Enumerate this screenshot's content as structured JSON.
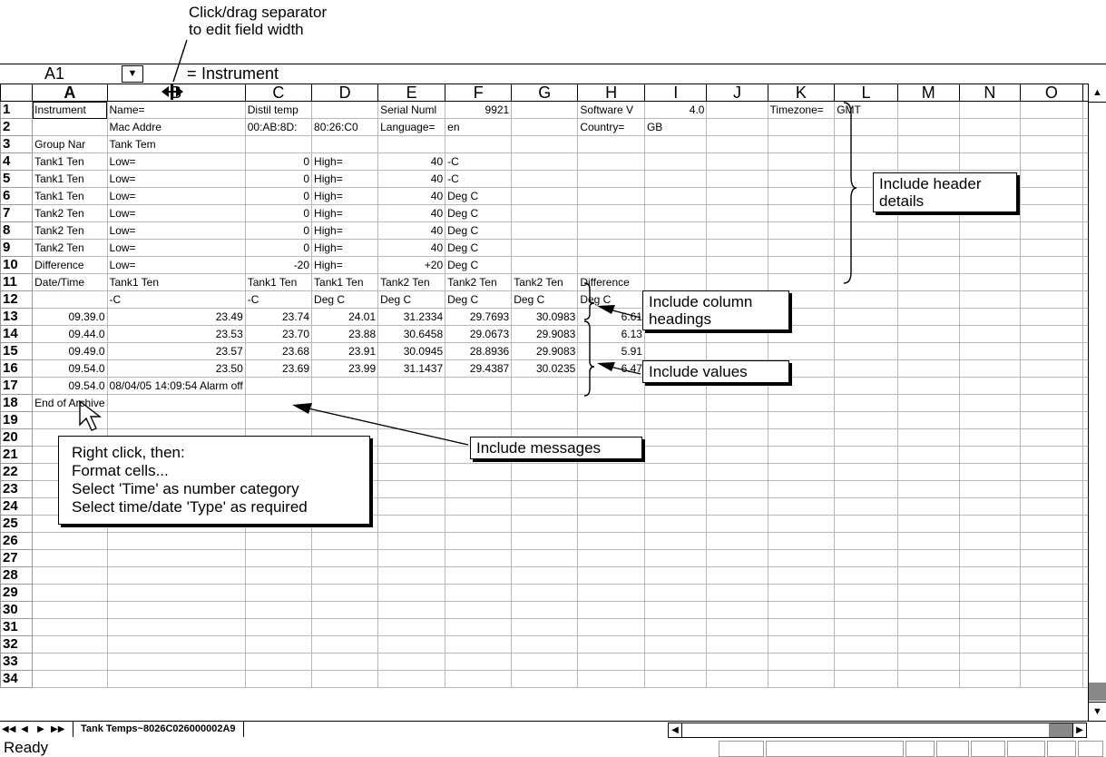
{
  "annotations": {
    "top_line1": "Click/drag separator",
    "top_line2": "to edit field width",
    "header": "Include header details",
    "column_headings": "Include column headings",
    "values": "Include values",
    "messages": "Include messages",
    "format_lines": [
      "Right click, then:",
      "Format cells...",
      "Select 'Time' as number category",
      "Select time/date 'Type' as required"
    ]
  },
  "formula_bar": {
    "cell_ref": "A1",
    "equals": "=",
    "value": "Instrument"
  },
  "columns": [
    "A",
    "B",
    "C",
    "D",
    "E",
    "F",
    "G",
    "H",
    "I",
    "J",
    "K",
    "L",
    "M",
    "N",
    "O"
  ],
  "rows": [
    [
      "Instrument",
      "Name=",
      "Distil temp",
      "",
      "Serial Numl",
      "9921",
      "",
      "Software V",
      "4.0",
      "",
      "Timezone=",
      "GMT",
      "",
      "",
      ""
    ],
    [
      "",
      "Mac Addre",
      "00:AB:8D:",
      "80:26:C0",
      "Language=",
      "en",
      "",
      "Country=",
      "GB",
      "",
      "",
      "",
      "",
      "",
      ""
    ],
    [
      "Group Nar",
      "Tank Tem",
      "",
      "",
      "",
      "",
      "",
      "",
      "",
      "",
      "",
      "",
      "",
      "",
      ""
    ],
    [
      "Tank1 Ten",
      "Low=",
      "0",
      "High=",
      "40",
      "-C",
      "",
      "",
      "",
      "",
      "",
      "",
      "",
      "",
      ""
    ],
    [
      "Tank1 Ten",
      "Low=",
      "0",
      "High=",
      "40",
      "-C",
      "",
      "",
      "",
      "",
      "",
      "",
      "",
      "",
      ""
    ],
    [
      "Tank1 Ten",
      "Low=",
      "0",
      "High=",
      "40",
      "Deg C",
      "",
      "",
      "",
      "",
      "",
      "",
      "",
      "",
      ""
    ],
    [
      "Tank2 Ten",
      "Low=",
      "0",
      "High=",
      "40",
      "Deg C",
      "",
      "",
      "",
      "",
      "",
      "",
      "",
      "",
      ""
    ],
    [
      "Tank2 Ten",
      "Low=",
      "0",
      "High=",
      "40",
      "Deg C",
      "",
      "",
      "",
      "",
      "",
      "",
      "",
      "",
      ""
    ],
    [
      "Tank2 Ten",
      "Low=",
      "0",
      "High=",
      "40",
      "Deg C",
      "",
      "",
      "",
      "",
      "",
      "",
      "",
      "",
      ""
    ],
    [
      "Difference",
      "Low=",
      "-20",
      "High=",
      "+20",
      "Deg C",
      "",
      "",
      "",
      "",
      "",
      "",
      "",
      "",
      ""
    ],
    [
      "Date/Time",
      "Tank1 Ten",
      "Tank1 Ten",
      "Tank1 Ten",
      "Tank2 Ten",
      "Tank2 Ten",
      "Tank2 Ten",
      "Difference",
      "",
      "",
      "",
      "",
      "",
      "",
      ""
    ],
    [
      "",
      "-C",
      "-C",
      "Deg C",
      "Deg C",
      "Deg C",
      "Deg C",
      "Deg C",
      "",
      "",
      "",
      "",
      "",
      "",
      ""
    ],
    [
      "09.39.0",
      "23.49",
      "23.74",
      "24.01",
      "31.2334",
      "29.7693",
      "30.0983",
      "6.61",
      "",
      "",
      "",
      "",
      "",
      "",
      ""
    ],
    [
      "09.44.0",
      "23.53",
      "23.70",
      "23.88",
      "30.6458",
      "29.0673",
      "29.9083",
      "6.13",
      "",
      "",
      "",
      "",
      "",
      "",
      ""
    ],
    [
      "09.49.0",
      "23.57",
      "23.68",
      "23.91",
      "30.0945",
      "28.8936",
      "29.9083",
      "5.91",
      "",
      "",
      "",
      "",
      "",
      "",
      ""
    ],
    [
      "09.54.0",
      "23.50",
      "23.69",
      "23.99",
      "31.1437",
      "29.4387",
      "30.0235",
      "6.47",
      "",
      "",
      "",
      "",
      "",
      "",
      ""
    ],
    [
      "09.54.0",
      "08/04/05 14:09:54 Alarm off",
      "",
      "",
      "",
      "",
      "",
      "",
      "",
      "",
      "",
      "",
      "",
      "",
      ""
    ],
    [
      "End of Archive",
      "",
      "",
      "",
      "",
      "",
      "",
      "",
      "",
      "",
      "",
      "",
      "",
      "",
      ""
    ]
  ],
  "total_rows": 34,
  "sheet_tab": "Tank Temps~8026C026000002A9",
  "status": "Ready"
}
